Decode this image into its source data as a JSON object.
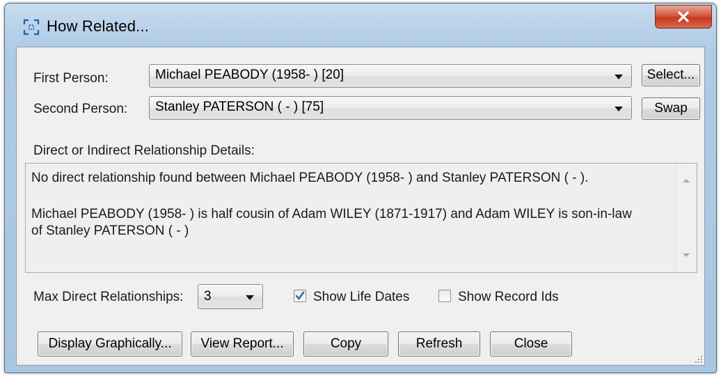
{
  "window": {
    "title": "How Related..."
  },
  "form": {
    "first_person_label": "First Person:",
    "first_person_value": "Michael PEABODY (1958- ) [20]",
    "select_button": "Select...",
    "second_person_label": "Second Person:",
    "second_person_value": "Stanley PATERSON ( - ) [75]",
    "swap_button": "Swap"
  },
  "details": {
    "label": "Direct or Indirect Relationship Details:",
    "lines": [
      "No direct relationship found between Michael PEABODY (1958- ) and Stanley PATERSON ( - ).",
      "Michael PEABODY (1958- ) is half cousin of Adam WILEY (1871-1917) and Adam WILEY is son-in-law",
      "of Stanley PATERSON ( - )"
    ]
  },
  "options": {
    "max_label": "Max Direct Relationships:",
    "max_value": "3",
    "show_life_dates_label": "Show Life Dates",
    "show_life_dates_checked": true,
    "show_record_ids_label": "Show Record Ids",
    "show_record_ids_checked": false
  },
  "buttons": {
    "display_graphically": "Display Graphically...",
    "view_report": "View Report...",
    "copy": "Copy",
    "refresh": "Refresh",
    "close": "Close"
  },
  "colors": {
    "close_red": "#c8452b",
    "checkmark_blue": "#2c5ea6"
  }
}
